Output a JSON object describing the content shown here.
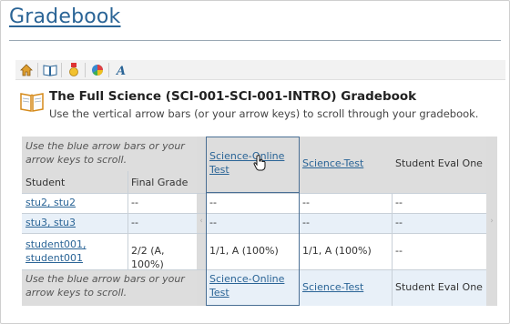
{
  "page": {
    "title": "Gradebook"
  },
  "toolbar": {
    "icons": [
      "home-icon",
      "book-icon",
      "ribbon-icon",
      "pie-chart-icon",
      "italic-a-icon"
    ]
  },
  "gradebook": {
    "title": "The Full Science (SCI-001-SCI-001-INTRO) Gradebook",
    "description": "Use the vertical arrow bars (or your arrow keys) to scroll through your gradebook."
  },
  "grid": {
    "scroll_hint": "Use the blue arrow bars or your arrow keys to scroll.",
    "col_student": "Student",
    "col_final": "Final Grade",
    "assignments": [
      "Science-Online Test",
      "Science-Test",
      "Student Eval One"
    ],
    "rows": [
      {
        "student": "stu2, stu2",
        "final": "--",
        "online": "--",
        "test": "--",
        "eval": "--"
      },
      {
        "student": "stu3, stu3",
        "final": "--",
        "online": "--",
        "test": "--",
        "eval": "--"
      },
      {
        "student": "student001, student001",
        "final": "2/2 (A, 100%)",
        "online": "1/1, A (100%)",
        "test": "1/1, A (100%)",
        "eval": "--"
      }
    ]
  },
  "colors": {
    "link": "#2a6496",
    "selected_border": "#4a6f94",
    "row_blue": "#e8f0f8",
    "header_gray": "#dddddd"
  }
}
